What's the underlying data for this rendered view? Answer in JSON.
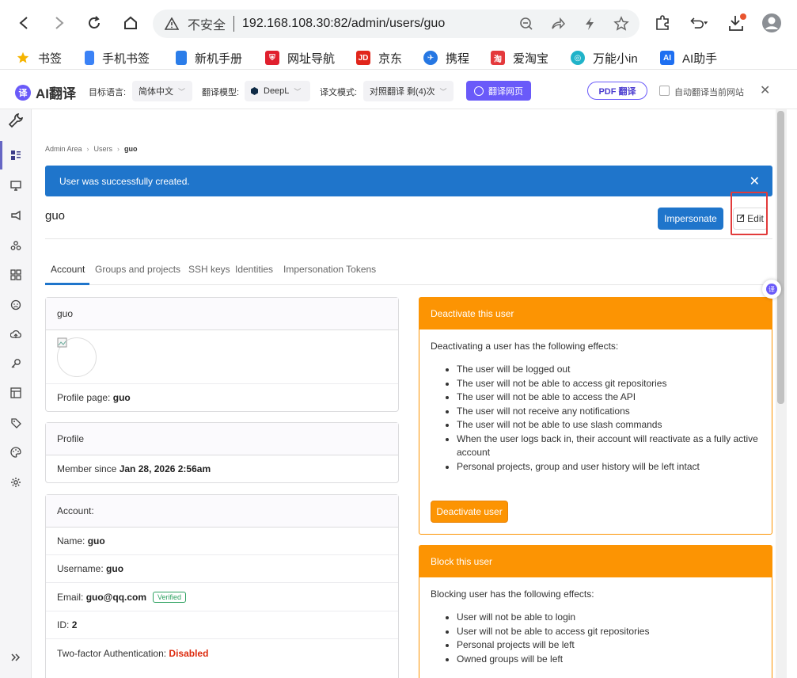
{
  "browser": {
    "insecure_label": "不安全",
    "url": "192.168.108.30:82/admin/users/guo"
  },
  "bookmarks": [
    {
      "label": "书签",
      "color": "#f5b400"
    },
    {
      "label": "手机书签",
      "color": "#3b82f6"
    },
    {
      "label": "新机手册",
      "color": "#2b7de9"
    },
    {
      "label": "网址导航",
      "color": "#e0202e"
    },
    {
      "label": "京东",
      "color": "#e1251b"
    },
    {
      "label": "携程",
      "color": "#2577e3"
    },
    {
      "label": "爱淘宝",
      "color": "#e4393c"
    },
    {
      "label": "万能小in",
      "color": "#20b3c9"
    },
    {
      "label": "AI助手",
      "color": "#1e6ff1"
    }
  ],
  "ai_bar": {
    "title": "AI翻译",
    "logo_char": "译",
    "target_lang_label": "目标语言:",
    "target_lang": "简体中文",
    "model_label": "翻译模型:",
    "model": "DeepL",
    "mode_label": "译文模式:",
    "mode": "对照翻译 剩(4)次",
    "translate_btn": "翻译网页",
    "pdf_btn": "PDF 翻译",
    "auto_label": "自动翻译当前网站"
  },
  "breadcrumb": [
    "Admin Area",
    "Users",
    "guo"
  ],
  "alert": {
    "message": "User was successfully created."
  },
  "page": {
    "username": "guo",
    "impersonate_label": "Impersonate",
    "edit_label": "Edit"
  },
  "tabs": [
    "Account",
    "Groups and projects",
    "SSH keys",
    "Identities",
    "Impersonation Tokens"
  ],
  "user_card": {
    "name": "guo",
    "profile_page_label": "Profile page:",
    "profile_page_value": "guo"
  },
  "profile_card": {
    "title": "Profile",
    "member_since_label": "Member since",
    "member_since_value": "Jan 28, 2026 2:56am"
  },
  "account_card": {
    "title": "Account:",
    "name_label": "Name:",
    "name_value": "guo",
    "username_label": "Username:",
    "username_value": "guo",
    "email_label": "Email:",
    "email_value": "guo@qq.com",
    "verified_badge": "Verified",
    "id_label": "ID:",
    "id_value": "2",
    "tfa_label": "Two-factor Authentication:",
    "tfa_value": "Disabled"
  },
  "deactivate_card": {
    "title": "Deactivate this user",
    "intro": "Deactivating a user has the following effects:",
    "items": [
      "The user will be logged out",
      "The user will not be able to access git repositories",
      "The user will not be able to access the API",
      "The user will not receive any notifications",
      "The user will not be able to use slash commands",
      "When the user logs back in, their account will reactivate as a fully active account",
      "Personal projects, group and user history will be left intact"
    ],
    "button": "Deactivate user"
  },
  "block_card": {
    "title": "Block this user",
    "intro": "Blocking user has the following effects:",
    "items": [
      "User will not be able to login",
      "User will not be able to access git repositories",
      "Personal projects will be left",
      "Owned groups will be left"
    ]
  },
  "colors": {
    "primary": "#1f75cb",
    "warning": "#fc9403",
    "danger": "#dd2b0e",
    "success": "#2da160",
    "ai_purple": "#6a5af9"
  }
}
